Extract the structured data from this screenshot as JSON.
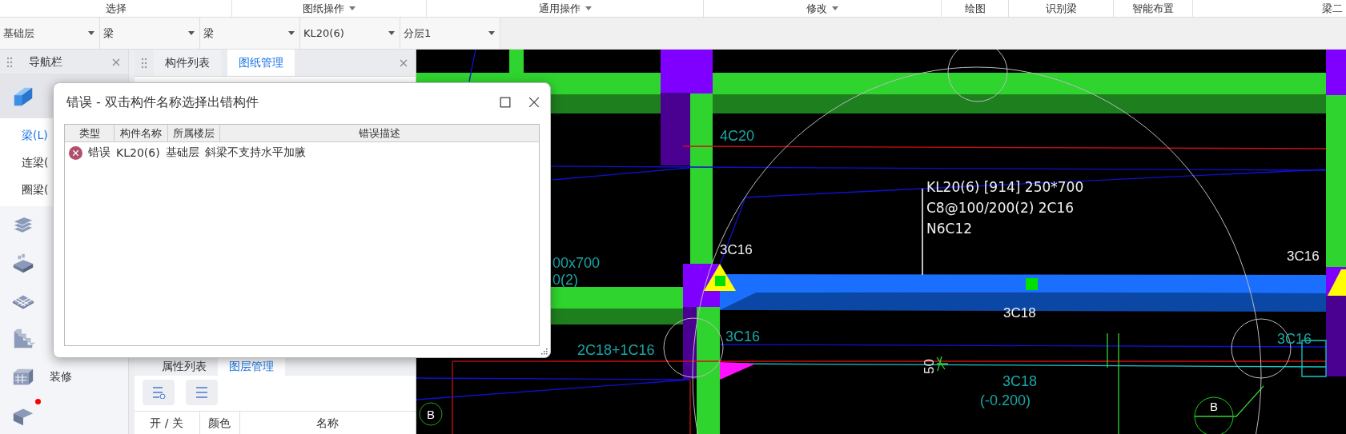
{
  "ribbon_groups": [
    {
      "label": "选择",
      "dropdown": false
    },
    {
      "label": "图纸操作",
      "dropdown": true
    },
    {
      "label": "通用操作",
      "dropdown": true
    },
    {
      "label": "修改",
      "dropdown": true
    },
    {
      "label": "绘图",
      "dropdown": false
    },
    {
      "label": "识别梁",
      "dropdown": false
    },
    {
      "label": "智能布置",
      "dropdown": false
    },
    {
      "label": "梁二",
      "dropdown": false
    }
  ],
  "selectors": [
    {
      "value": "基础层"
    },
    {
      "value": "梁"
    },
    {
      "value": "梁"
    },
    {
      "value": "KL20(6)"
    },
    {
      "value": "分层1"
    }
  ],
  "nav_panel": {
    "title": "导航栏",
    "categories": [
      {
        "kind": "beam",
        "selected": true,
        "children": [
          {
            "label": "梁(L)",
            "selected": true
          },
          {
            "label": "连梁(",
            "selected": false
          },
          {
            "label": "圈梁(",
            "selected": false
          }
        ]
      },
      {
        "kind": "slab",
        "selected": false
      },
      {
        "kind": "opening",
        "selected": false
      },
      {
        "kind": "grid",
        "selected": false
      },
      {
        "kind": "stairs",
        "selected": false
      },
      {
        "kind": "finish",
        "selected": false,
        "label": "装修"
      },
      {
        "kind": "pit",
        "selected": false,
        "alert": true
      }
    ]
  },
  "component_panel": {
    "tabs": [
      {
        "label": "构件列表",
        "selected": false
      },
      {
        "label": "图纸管理",
        "selected": true
      }
    ]
  },
  "layer_panel": {
    "tabs": [
      {
        "label": "属性列表",
        "selected": false
      },
      {
        "label": "图层管理",
        "selected": true
      }
    ],
    "columns": [
      "开 / 关",
      "颜色",
      "名称"
    ]
  },
  "error_dialog": {
    "title": "错误 - 双击构件名称选择出错构件",
    "columns": [
      "类型",
      "构件名称",
      "所属楼层",
      "错误描述"
    ],
    "rows": [
      {
        "kind": "error",
        "type": "错误",
        "name": "KL20(6)",
        "floor": "基础层",
        "description": "斜梁不支持水平加腋"
      }
    ]
  },
  "drawing": {
    "beam_annotation": [
      "KL20(6) [914] 250*700",
      "C8@100/200(2) 2C16",
      "N6C12"
    ],
    "labels": [
      {
        "text": "4C20",
        "kind": "rebar"
      },
      {
        "text": "3C16",
        "kind": "active"
      },
      {
        "text": "00x700",
        "kind": "rebar"
      },
      {
        "text": "0(2)",
        "kind": "rebar"
      },
      {
        "text": "3C16",
        "kind": "rebar"
      },
      {
        "text": "2C18+1C16",
        "kind": "rebar"
      },
      {
        "text": "3C18",
        "kind": "active"
      },
      {
        "text": "3C16",
        "kind": "active"
      },
      {
        "text": "3C16",
        "kind": "rebar"
      },
      {
        "text": "3C18",
        "kind": "rebar"
      },
      {
        "text": "(-0.200)",
        "kind": "rebar"
      },
      {
        "text": "50",
        "kind": "dimension"
      },
      {
        "text": "B",
        "kind": "axis"
      },
      {
        "text": "B",
        "kind": "axis"
      }
    ]
  }
}
